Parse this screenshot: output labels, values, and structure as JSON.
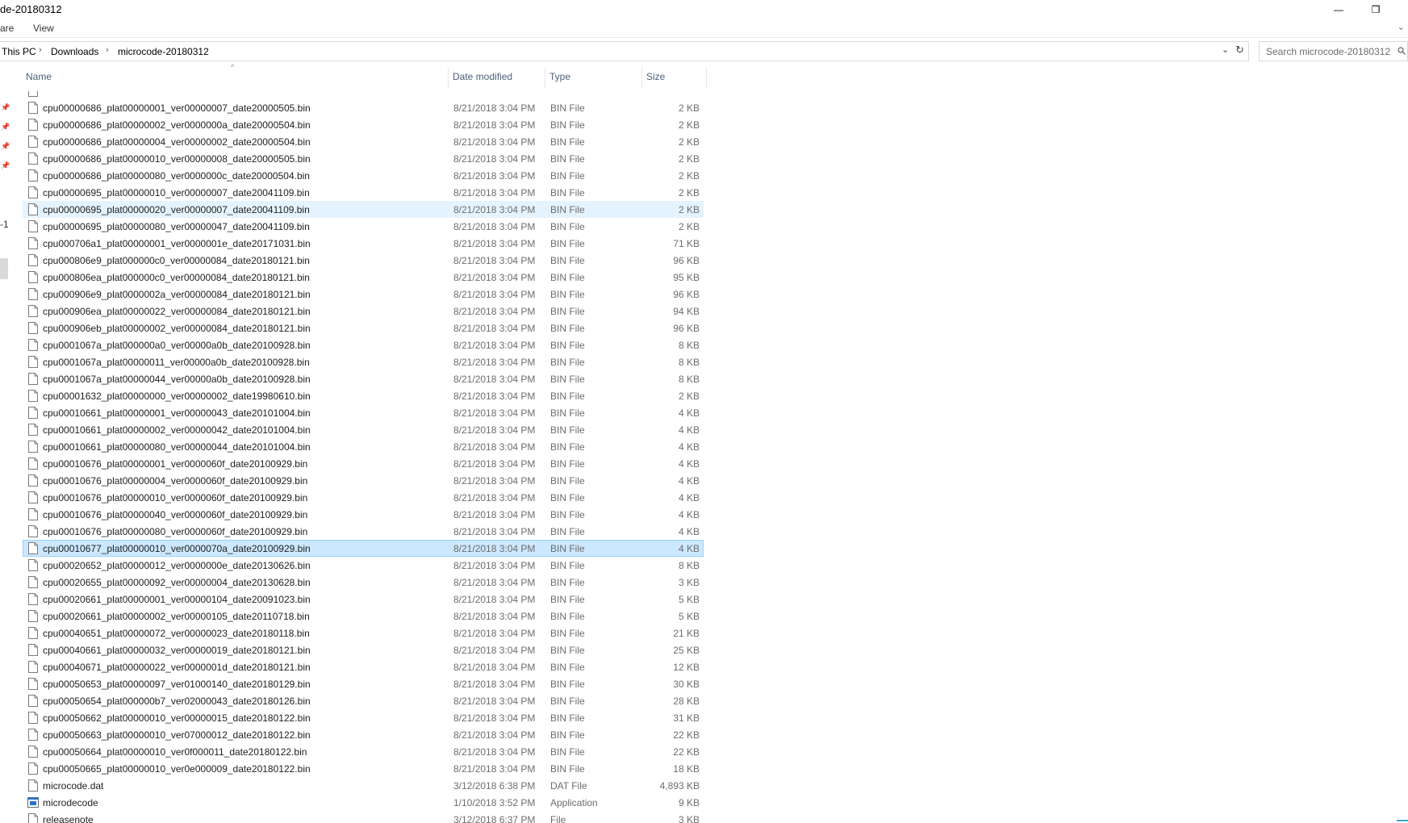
{
  "window": {
    "title": "de-20180312",
    "minimize_glyph": "—",
    "restore_glyph": "❐"
  },
  "ribbon": {
    "tabs": [
      "are",
      "View"
    ],
    "expand_glyph": "⌄"
  },
  "address": {
    "crumbs": [
      "This PC",
      "Downloads",
      "microcode-20180312"
    ],
    "separator": "›",
    "dropdown_glyph": "⌄",
    "refresh_glyph": "↻"
  },
  "search": {
    "placeholder": "Search microcode-20180312"
  },
  "nav": {
    "pins": [
      "📌",
      "📌",
      "📌",
      "📌"
    ],
    "truncated_label": "-1"
  },
  "columns": {
    "name": "Name",
    "date": "Date modified",
    "type": "Type",
    "size": "Size",
    "sort_glyph": "^"
  },
  "files": [
    {
      "name": "cpu00000686_plat00000001_ver00000007_date20000505.bin",
      "date": "8/21/2018 3:04 PM",
      "type": "BIN File",
      "size": "2 KB"
    },
    {
      "name": "cpu00000686_plat00000002_ver0000000a_date20000504.bin",
      "date": "8/21/2018 3:04 PM",
      "type": "BIN File",
      "size": "2 KB"
    },
    {
      "name": "cpu00000686_plat00000004_ver00000002_date20000504.bin",
      "date": "8/21/2018 3:04 PM",
      "type": "BIN File",
      "size": "2 KB"
    },
    {
      "name": "cpu00000686_plat00000010_ver00000008_date20000505.bin",
      "date": "8/21/2018 3:04 PM",
      "type": "BIN File",
      "size": "2 KB"
    },
    {
      "name": "cpu00000686_plat00000080_ver0000000c_date20000504.bin",
      "date": "8/21/2018 3:04 PM",
      "type": "BIN File",
      "size": "2 KB"
    },
    {
      "name": "cpu00000695_plat00000010_ver00000007_date20041109.bin",
      "date": "8/21/2018 3:04 PM",
      "type": "BIN File",
      "size": "2 KB"
    },
    {
      "name": "cpu00000695_plat00000020_ver00000007_date20041109.bin",
      "date": "8/21/2018 3:04 PM",
      "type": "BIN File",
      "size": "2 KB",
      "state": "hover"
    },
    {
      "name": "cpu00000695_plat00000080_ver00000047_date20041109.bin",
      "date": "8/21/2018 3:04 PM",
      "type": "BIN File",
      "size": "2 KB"
    },
    {
      "name": "cpu000706a1_plat00000001_ver0000001e_date20171031.bin",
      "date": "8/21/2018 3:04 PM",
      "type": "BIN File",
      "size": "71 KB"
    },
    {
      "name": "cpu000806e9_plat000000c0_ver00000084_date20180121.bin",
      "date": "8/21/2018 3:04 PM",
      "type": "BIN File",
      "size": "96 KB"
    },
    {
      "name": "cpu000806ea_plat000000c0_ver00000084_date20180121.bin",
      "date": "8/21/2018 3:04 PM",
      "type": "BIN File",
      "size": "95 KB"
    },
    {
      "name": "cpu000906e9_plat0000002a_ver00000084_date20180121.bin",
      "date": "8/21/2018 3:04 PM",
      "type": "BIN File",
      "size": "96 KB"
    },
    {
      "name": "cpu000906ea_plat00000022_ver00000084_date20180121.bin",
      "date": "8/21/2018 3:04 PM",
      "type": "BIN File",
      "size": "94 KB"
    },
    {
      "name": "cpu000906eb_plat00000002_ver00000084_date20180121.bin",
      "date": "8/21/2018 3:04 PM",
      "type": "BIN File",
      "size": "96 KB"
    },
    {
      "name": "cpu0001067a_plat000000a0_ver00000a0b_date20100928.bin",
      "date": "8/21/2018 3:04 PM",
      "type": "BIN File",
      "size": "8 KB"
    },
    {
      "name": "cpu0001067a_plat00000011_ver00000a0b_date20100928.bin",
      "date": "8/21/2018 3:04 PM",
      "type": "BIN File",
      "size": "8 KB"
    },
    {
      "name": "cpu0001067a_plat00000044_ver00000a0b_date20100928.bin",
      "date": "8/21/2018 3:04 PM",
      "type": "BIN File",
      "size": "8 KB"
    },
    {
      "name": "cpu00001632_plat00000000_ver00000002_date19980610.bin",
      "date": "8/21/2018 3:04 PM",
      "type": "BIN File",
      "size": "2 KB"
    },
    {
      "name": "cpu00010661_plat00000001_ver00000043_date20101004.bin",
      "date": "8/21/2018 3:04 PM",
      "type": "BIN File",
      "size": "4 KB"
    },
    {
      "name": "cpu00010661_plat00000002_ver00000042_date20101004.bin",
      "date": "8/21/2018 3:04 PM",
      "type": "BIN File",
      "size": "4 KB"
    },
    {
      "name": "cpu00010661_plat00000080_ver00000044_date20101004.bin",
      "date": "8/21/2018 3:04 PM",
      "type": "BIN File",
      "size": "4 KB"
    },
    {
      "name": "cpu00010676_plat00000001_ver0000060f_date20100929.bin",
      "date": "8/21/2018 3:04 PM",
      "type": "BIN File",
      "size": "4 KB"
    },
    {
      "name": "cpu00010676_plat00000004_ver0000060f_date20100929.bin",
      "date": "8/21/2018 3:04 PM",
      "type": "BIN File",
      "size": "4 KB"
    },
    {
      "name": "cpu00010676_plat00000010_ver0000060f_date20100929.bin",
      "date": "8/21/2018 3:04 PM",
      "type": "BIN File",
      "size": "4 KB"
    },
    {
      "name": "cpu00010676_plat00000040_ver0000060f_date20100929.bin",
      "date": "8/21/2018 3:04 PM",
      "type": "BIN File",
      "size": "4 KB"
    },
    {
      "name": "cpu00010676_plat00000080_ver0000060f_date20100929.bin",
      "date": "8/21/2018 3:04 PM",
      "type": "BIN File",
      "size": "4 KB"
    },
    {
      "name": "cpu00010677_plat00000010_ver0000070a_date20100929.bin",
      "date": "8/21/2018 3:04 PM",
      "type": "BIN File",
      "size": "4 KB",
      "state": "selected"
    },
    {
      "name": "cpu00020652_plat00000012_ver0000000e_date20130626.bin",
      "date": "8/21/2018 3:04 PM",
      "type": "BIN File",
      "size": "8 KB"
    },
    {
      "name": "cpu00020655_plat00000092_ver00000004_date20130628.bin",
      "date": "8/21/2018 3:04 PM",
      "type": "BIN File",
      "size": "3 KB"
    },
    {
      "name": "cpu00020661_plat00000001_ver00000104_date20091023.bin",
      "date": "8/21/2018 3:04 PM",
      "type": "BIN File",
      "size": "5 KB"
    },
    {
      "name": "cpu00020661_plat00000002_ver00000105_date20110718.bin",
      "date": "8/21/2018 3:04 PM",
      "type": "BIN File",
      "size": "5 KB"
    },
    {
      "name": "cpu00040651_plat00000072_ver00000023_date20180118.bin",
      "date": "8/21/2018 3:04 PM",
      "type": "BIN File",
      "size": "21 KB"
    },
    {
      "name": "cpu00040661_plat00000032_ver00000019_date20180121.bin",
      "date": "8/21/2018 3:04 PM",
      "type": "BIN File",
      "size": "25 KB"
    },
    {
      "name": "cpu00040671_plat00000022_ver0000001d_date20180121.bin",
      "date": "8/21/2018 3:04 PM",
      "type": "BIN File",
      "size": "12 KB"
    },
    {
      "name": "cpu00050653_plat00000097_ver01000140_date20180129.bin",
      "date": "8/21/2018 3:04 PM",
      "type": "BIN File",
      "size": "30 KB"
    },
    {
      "name": "cpu00050654_plat000000b7_ver02000043_date20180126.bin",
      "date": "8/21/2018 3:04 PM",
      "type": "BIN File",
      "size": "28 KB"
    },
    {
      "name": "cpu00050662_plat00000010_ver00000015_date20180122.bin",
      "date": "8/21/2018 3:04 PM",
      "type": "BIN File",
      "size": "31 KB"
    },
    {
      "name": "cpu00050663_plat00000010_ver07000012_date20180122.bin",
      "date": "8/21/2018 3:04 PM",
      "type": "BIN File",
      "size": "22 KB"
    },
    {
      "name": "cpu00050664_plat00000010_ver0f000011_date20180122.bin",
      "date": "8/21/2018 3:04 PM",
      "type": "BIN File",
      "size": "22 KB"
    },
    {
      "name": "cpu00050665_plat00000010_ver0e000009_date20180122.bin",
      "date": "8/21/2018 3:04 PM",
      "type": "BIN File",
      "size": "18 KB"
    },
    {
      "name": "microcode.dat",
      "date": "3/12/2018 6:38 PM",
      "type": "DAT File",
      "size": "4,893 KB"
    },
    {
      "name": "microdecode",
      "date": "1/10/2018 3:52 PM",
      "type": "Application",
      "size": "9 KB",
      "icon": "application-icon"
    },
    {
      "name": "releasenote",
      "date": "3/12/2018 6:37 PM",
      "type": "File",
      "size": "3 KB"
    }
  ],
  "colors": {
    "hover_bg": "#e5f3ff",
    "selected_bg": "#cce8ff",
    "selected_border": "#99d1ff",
    "header_text": "#4c607a"
  }
}
